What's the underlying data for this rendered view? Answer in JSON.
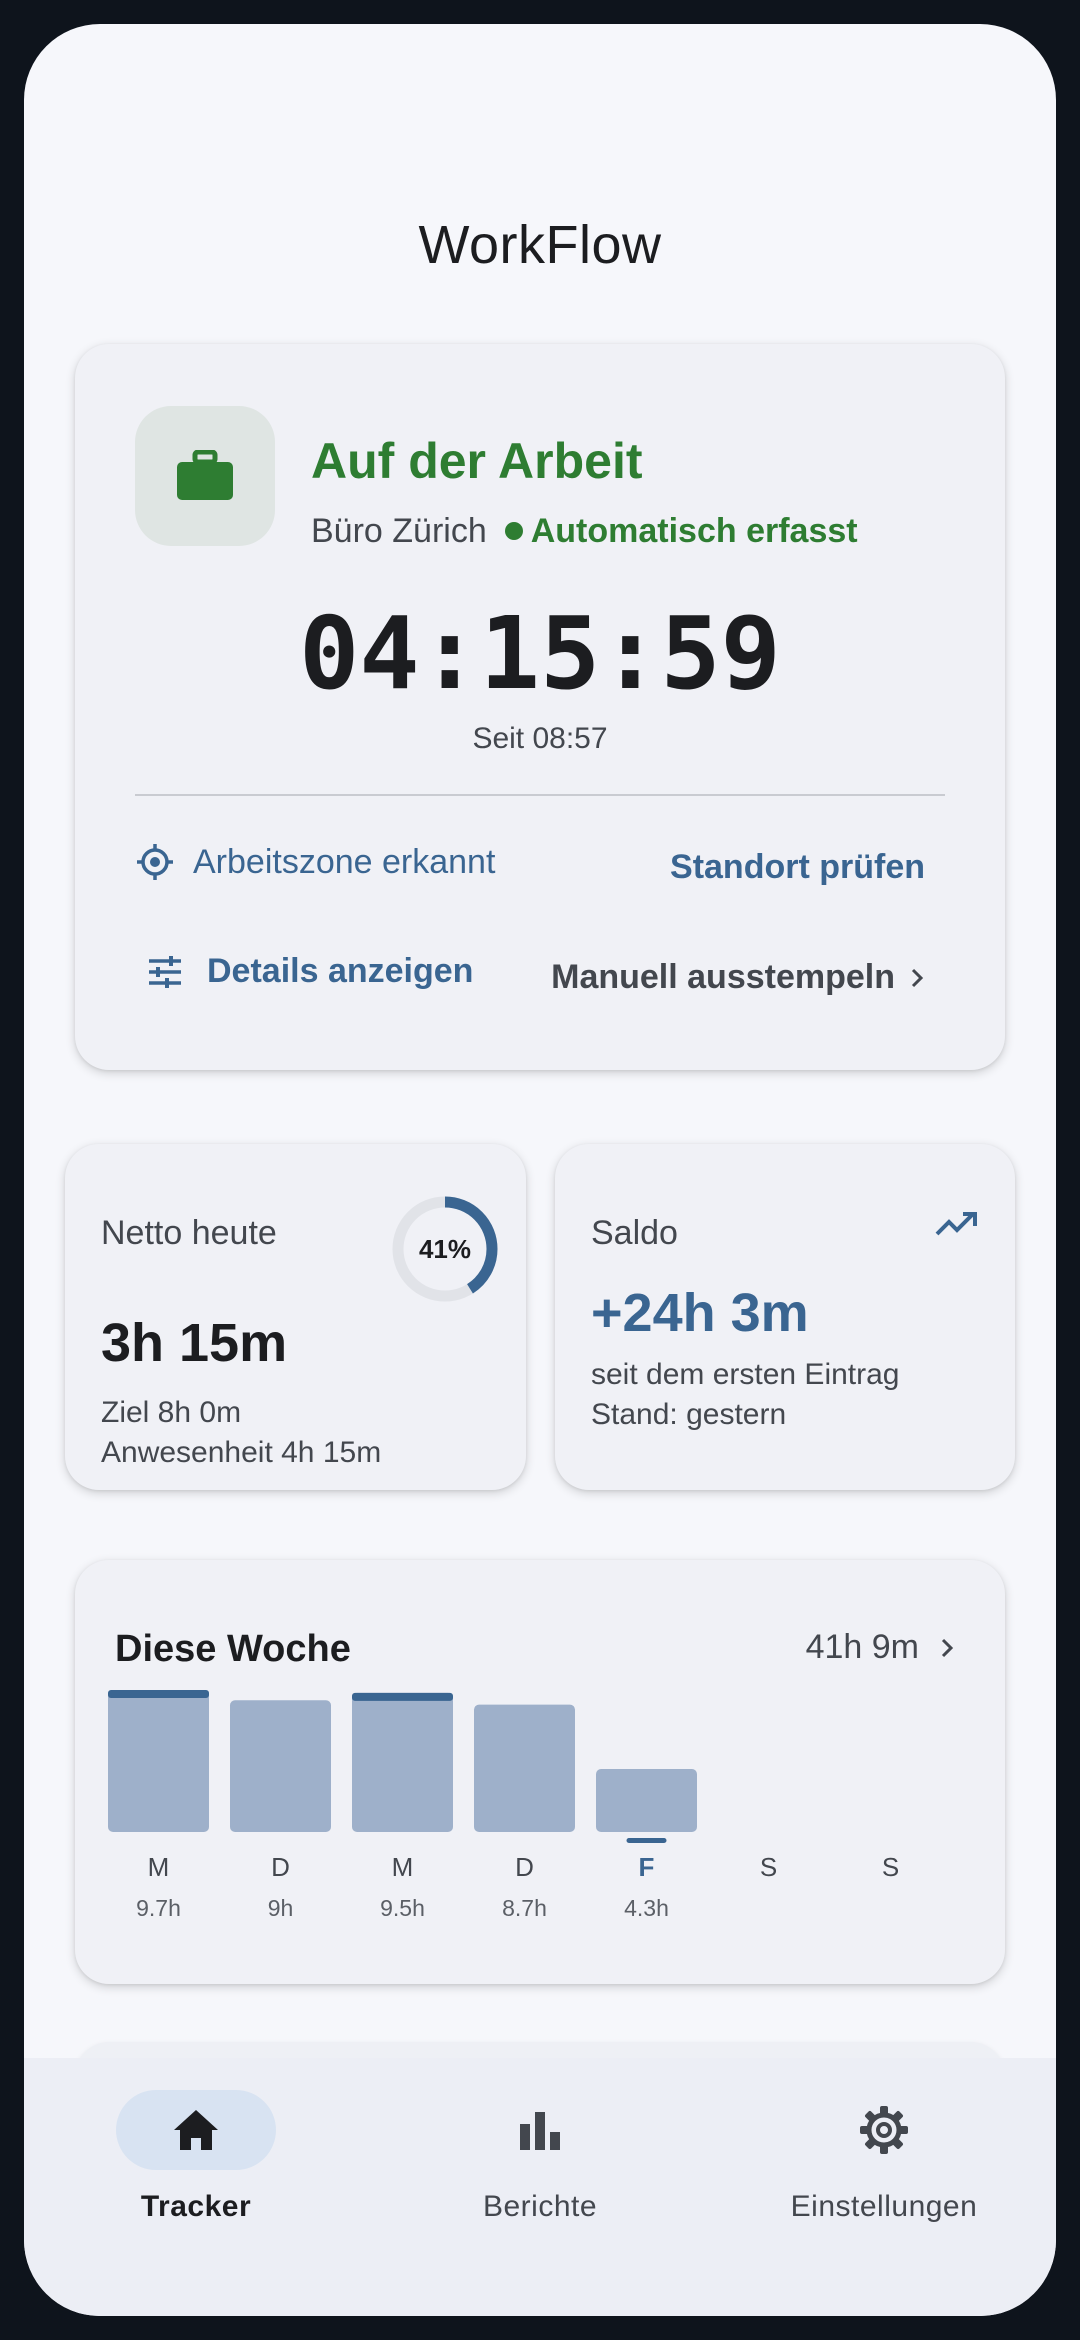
{
  "app": {
    "title": "WorkFlow"
  },
  "status": {
    "title": "Auf der Arbeit",
    "location": "Büro Zürich",
    "mode": "Automatisch erfasst",
    "icon": "briefcase-icon",
    "timer": "04:15:59",
    "since": "Seit 08:57",
    "zone_label": "Arbeitszone erkannt",
    "check_location": "Standort prüfen",
    "details": "Details anzeigen",
    "manual_out": "Manuell ausstempeln",
    "accent_color": "#2e7d32"
  },
  "netto": {
    "label": "Netto heute",
    "percent_label": "41%",
    "percent": 0.41,
    "value": "3h 15m",
    "goal": "Ziel 8h 0m",
    "presence": "Anwesenheit 4h 15m"
  },
  "saldo": {
    "label": "Saldo",
    "value": "+24h 3m",
    "line1": "seit dem ersten Eintrag",
    "line2": "Stand: gestern",
    "icon": "trending-up-icon"
  },
  "week": {
    "title": "Diese Woche",
    "total": "41h 9m"
  },
  "chart_data": {
    "type": "bar",
    "categories": [
      "M",
      "D",
      "M",
      "D",
      "F",
      "S",
      "S"
    ],
    "values": [
      9.7,
      9.0,
      9.5,
      8.7,
      4.3,
      0,
      0
    ],
    "value_labels": [
      "9.7h",
      "9h",
      "9.5h",
      "8.7h",
      "4.3h",
      "",
      ""
    ],
    "highlight_index": 4,
    "overtime_indices": [
      0,
      2
    ],
    "bar_color": "#9eb0ca",
    "accent_color": "#3a6591"
  },
  "nav": {
    "items": [
      {
        "label": "Tracker",
        "icon": "home-icon",
        "active": true
      },
      {
        "label": "Berichte",
        "icon": "bar-chart-icon",
        "active": false
      },
      {
        "label": "Einstellungen",
        "icon": "gear-icon",
        "active": false
      }
    ]
  }
}
